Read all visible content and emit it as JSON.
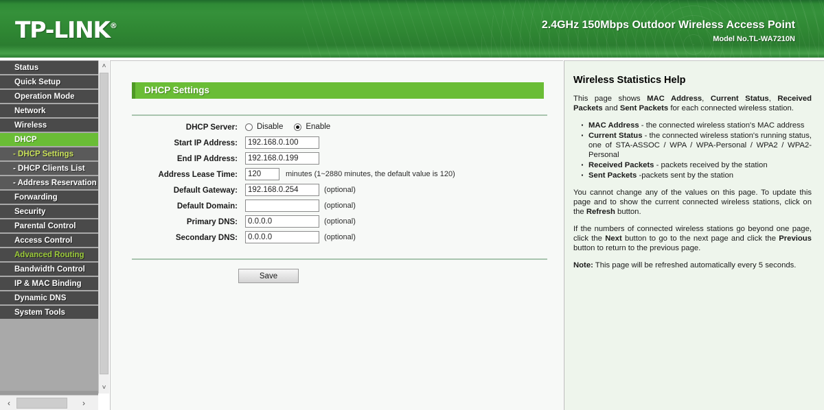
{
  "header": {
    "logo": "TP-LINK",
    "logo_reg": "®",
    "product_title": "2.4GHz 150Mbps Outdoor Wireless Access Point",
    "model": "Model No.TL-WA7210N",
    "brand_color": "#2f8a36",
    "accent_color": "#6abd36"
  },
  "sidebar": {
    "items": [
      {
        "label": "Status",
        "type": "main",
        "state": "normal"
      },
      {
        "label": "Quick Setup",
        "type": "main",
        "state": "normal"
      },
      {
        "label": "Operation Mode",
        "type": "main",
        "state": "normal"
      },
      {
        "label": "Network",
        "type": "main",
        "state": "normal"
      },
      {
        "label": "Wireless",
        "type": "main",
        "state": "normal"
      },
      {
        "label": "DHCP",
        "type": "main",
        "state": "active"
      },
      {
        "label": "- DHCP Settings",
        "type": "sub",
        "state": "sub-active"
      },
      {
        "label": "- DHCP Clients List",
        "type": "sub",
        "state": "normal"
      },
      {
        "label": "- Address Reservation",
        "type": "sub",
        "state": "normal"
      },
      {
        "label": "Forwarding",
        "type": "main",
        "state": "normal"
      },
      {
        "label": "Security",
        "type": "main",
        "state": "normal"
      },
      {
        "label": "Parental Control",
        "type": "main",
        "state": "normal"
      },
      {
        "label": "Access Control",
        "type": "main",
        "state": "normal"
      },
      {
        "label": "Advanced Routing",
        "type": "main",
        "state": "hover"
      },
      {
        "label": "Bandwidth Control",
        "type": "main",
        "state": "normal"
      },
      {
        "label": "IP & MAC Binding",
        "type": "main",
        "state": "normal"
      },
      {
        "label": "Dynamic DNS",
        "type": "main",
        "state": "normal"
      },
      {
        "label": "System Tools",
        "type": "main",
        "state": "normal"
      }
    ],
    "scroll_up_icon": "˄",
    "scroll_down_icon": "˅",
    "scroll_left_icon": "‹",
    "scroll_right_icon": "›"
  },
  "main": {
    "page_title": "DHCP Settings",
    "fields": {
      "dhcp_server_label": "DHCP Server:",
      "dhcp_disable_label": "Disable",
      "dhcp_enable_label": "Enable",
      "dhcp_selected": "Enable",
      "start_ip_label": "Start IP Address:",
      "start_ip_value": "192.168.0.100",
      "end_ip_label": "End IP Address:",
      "end_ip_value": "192.168.0.199",
      "lease_time_label": "Address Lease Time:",
      "lease_time_value": "120",
      "lease_time_hint": "minutes (1~2880 minutes, the default value is 120)",
      "default_gateway_label": "Default Gateway:",
      "default_gateway_value": "192.168.0.254",
      "default_gateway_hint": "(optional)",
      "default_domain_label": "Default Domain:",
      "default_domain_value": "",
      "default_domain_hint": "(optional)",
      "primary_dns_label": "Primary DNS:",
      "primary_dns_value": "0.0.0.0",
      "primary_dns_hint": "(optional)",
      "secondary_dns_label": "Secondary DNS:",
      "secondary_dns_value": "0.0.0.0",
      "secondary_dns_hint": "(optional)"
    },
    "save_label": "Save"
  },
  "help": {
    "title": "Wireless Statistics Help",
    "intro_1": "This page shows ",
    "intro_b1": "MAC Address",
    "intro_2": ", ",
    "intro_b2": "Current Status",
    "intro_3": ", ",
    "intro_b3": "Received Packets",
    "intro_4": " and ",
    "intro_b4": "Sent Packets",
    "intro_5": " for each connected wireless station.",
    "bullets": [
      {
        "term": "MAC Address",
        "text": " - the connected wireless station's MAC address"
      },
      {
        "term": "Current Status",
        "text": " - the connected wireless station's running status, one of  STA-ASSOC / WPA / WPA-Personal / WPA2 / WPA2-Personal"
      },
      {
        "term": "Received Packets",
        "text": " - packets received by the station"
      },
      {
        "term": "Sent Packets",
        "text": " -packets sent by the station"
      }
    ],
    "para2_a": "You cannot change any of the values on this page. To update this page and to show the current connected wireless stations, click on the ",
    "para2_b": "Refresh",
    "para2_c": " button.",
    "para3_a": "If the numbers of connected wireless stations go beyond one page, click the ",
    "para3_b": "Next",
    "para3_c": " button to go to the next page and click the ",
    "para3_d": "Previous",
    "para3_e": " button to return to the previous page.",
    "note_label": "Note:",
    "note_text": " This page will be refreshed automatically every 5 seconds."
  }
}
